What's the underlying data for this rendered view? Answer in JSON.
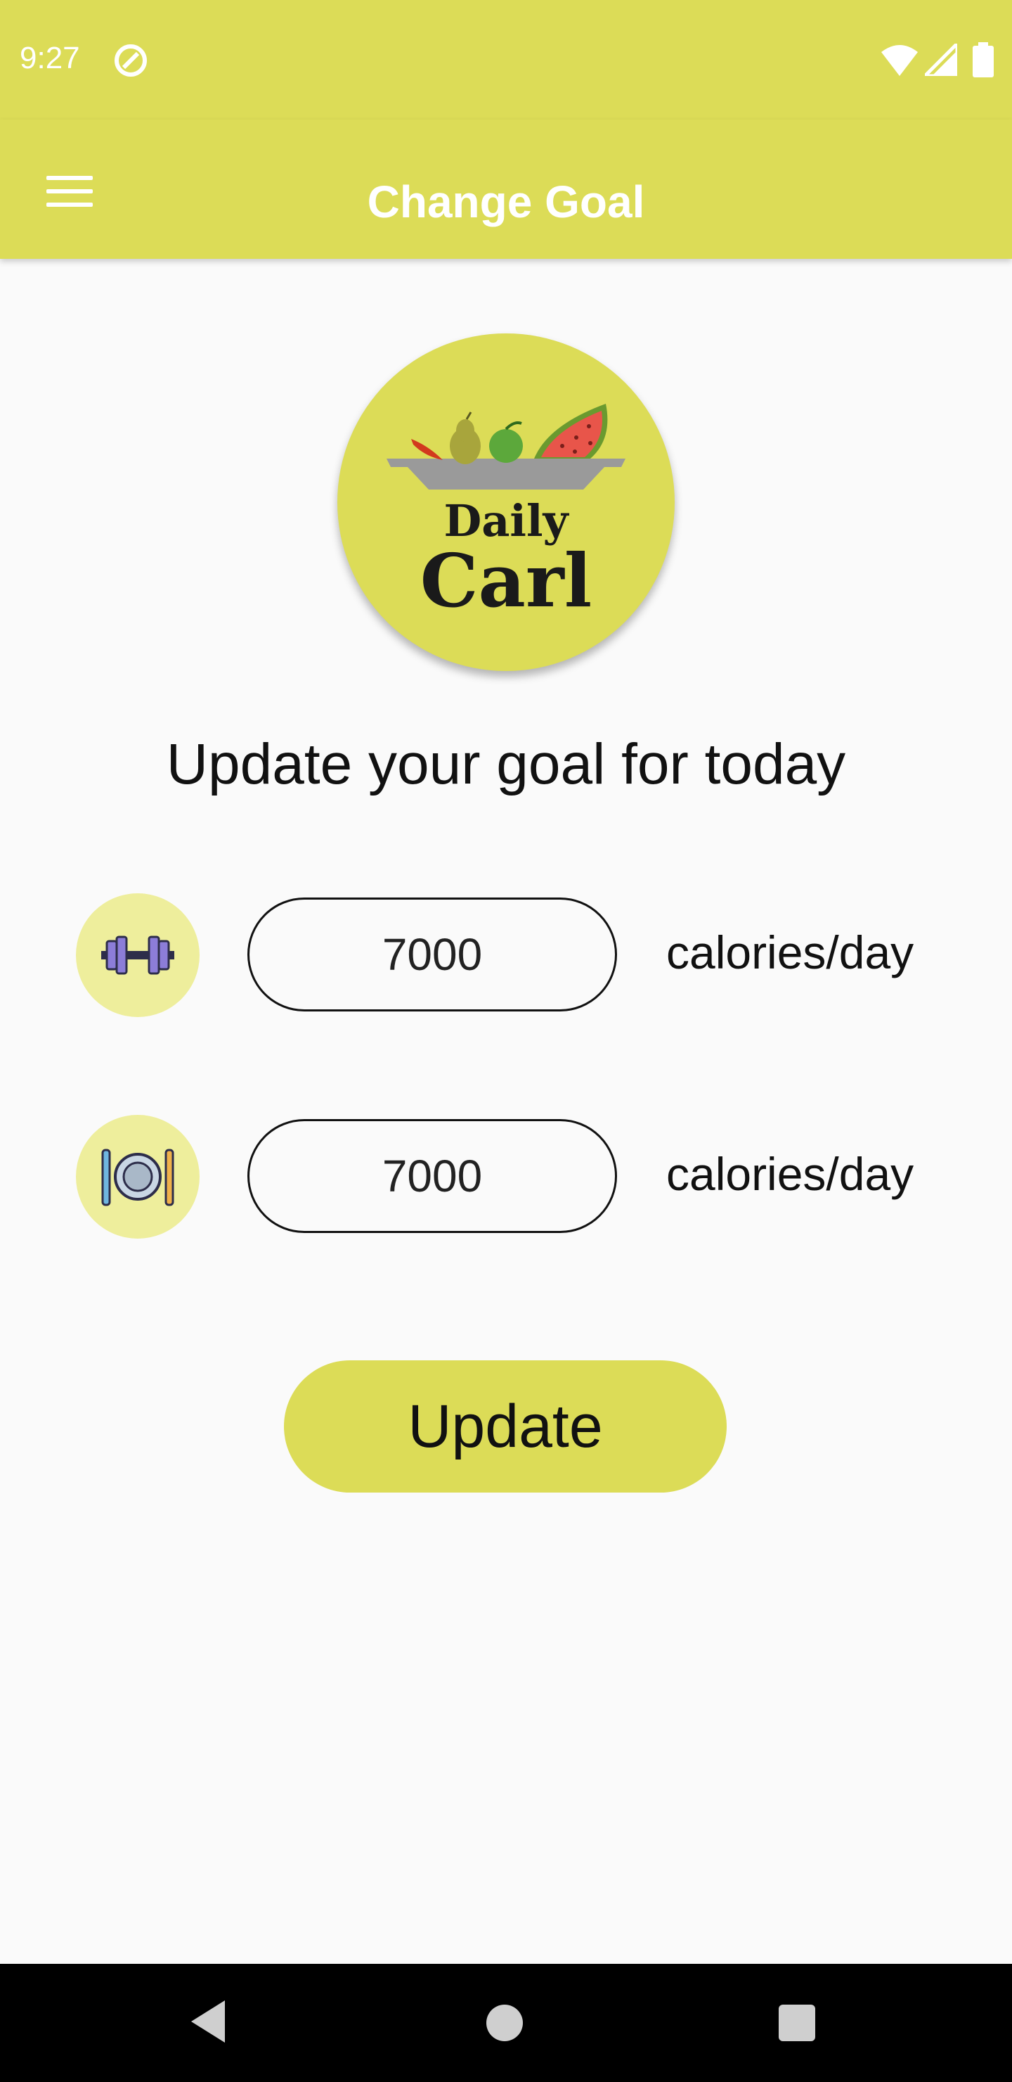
{
  "status_bar": {
    "time": "9:27",
    "icons": [
      "sync-icon",
      "wifi-icon",
      "signal-icon",
      "battery-icon"
    ]
  },
  "app_bar": {
    "title": "Change Goal",
    "menu_icon": "hamburger-menu-icon"
  },
  "logo": {
    "line1": "Daily",
    "line2": "Carl"
  },
  "heading": "Update your goal for today",
  "goals": [
    {
      "icon": "dumbbell-icon",
      "value": "7000",
      "unit": "calories/day"
    },
    {
      "icon": "plate-cutlery-icon",
      "value": "7000",
      "unit": "calories/day"
    }
  ],
  "update_button": {
    "label": "Update"
  },
  "colors": {
    "accent": "#dcdc57",
    "icon_bg": "#eeee9c",
    "background": "#fafafa"
  },
  "nav_bar": {
    "icons": [
      "back-icon",
      "home-icon",
      "recents-icon"
    ]
  }
}
